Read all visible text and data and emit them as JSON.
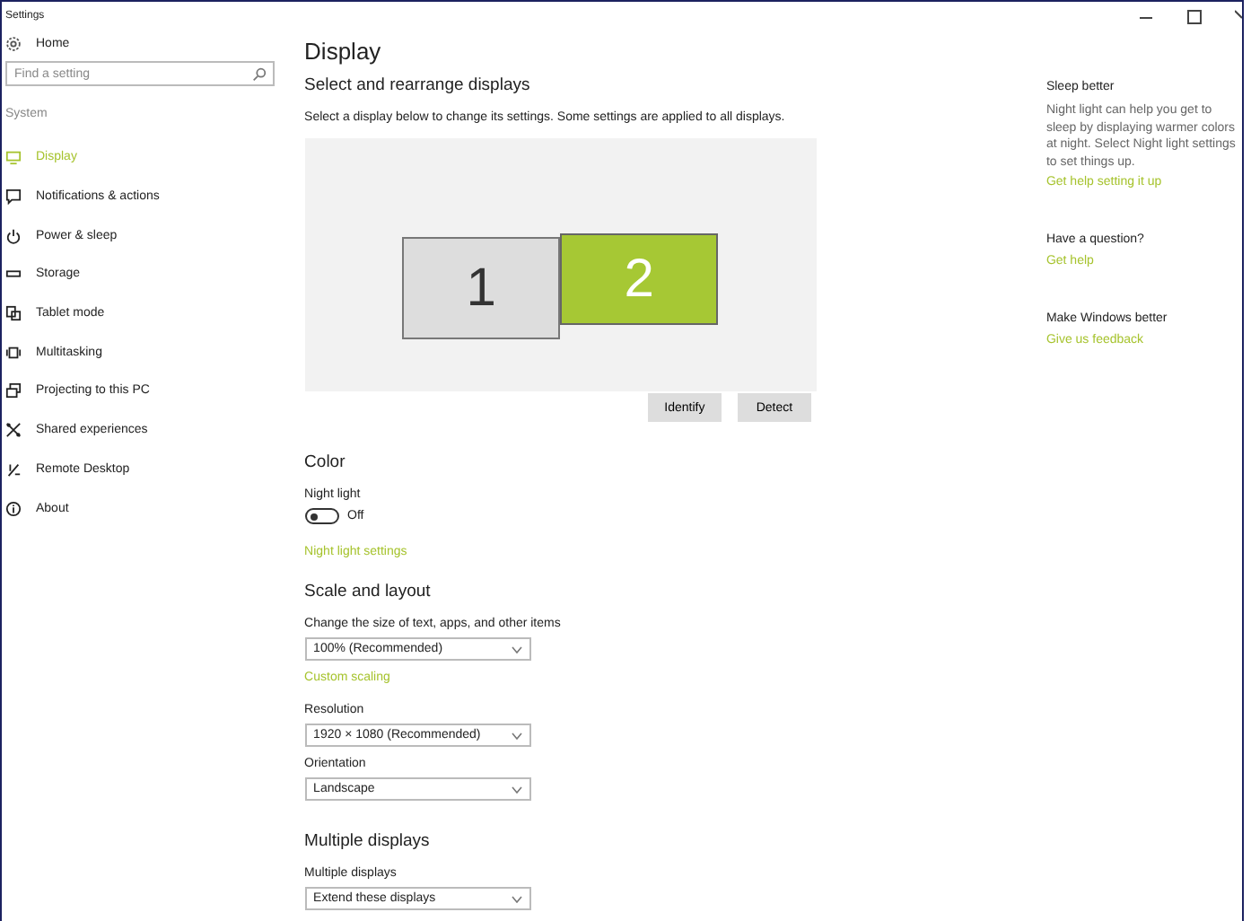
{
  "window": {
    "title": "Settings"
  },
  "sidebar": {
    "home": "Home",
    "search": {
      "placeholder": "Find a setting"
    },
    "group": "System",
    "items": [
      {
        "label": "Display",
        "selected": true
      },
      {
        "label": "Notifications & actions",
        "selected": false
      },
      {
        "label": "Power & sleep",
        "selected": false
      },
      {
        "label": "Storage",
        "selected": false
      },
      {
        "label": "Tablet mode",
        "selected": false
      },
      {
        "label": "Multitasking",
        "selected": false
      },
      {
        "label": "Projecting to this PC",
        "selected": false
      },
      {
        "label": "Shared experiences",
        "selected": false
      },
      {
        "label": "Remote Desktop",
        "selected": false
      },
      {
        "label": "About",
        "selected": false
      }
    ]
  },
  "page": {
    "title": "Display",
    "arrange": {
      "heading": "Select and rearrange displays",
      "description": "Select a display below to change its settings. Some settings are applied to all displays.",
      "displays": [
        {
          "label": "1",
          "selected": false
        },
        {
          "label": "2",
          "selected": true
        }
      ],
      "buttons": [
        "Identify",
        "Detect"
      ]
    },
    "color": {
      "heading": "Color",
      "night_light": {
        "label": "Night light",
        "on": false,
        "state_text": "Off"
      },
      "link": "Night light settings"
    },
    "scale": {
      "heading": "Scale and layout",
      "size": {
        "label": "Change the size of text, apps, and other items",
        "value": "100% (Recommended)"
      },
      "link": "Custom scaling",
      "resolution": {
        "label": "Resolution",
        "value": "1920 × 1080 (Recommended)"
      },
      "orientation": {
        "label": "Orientation",
        "value": "Landscape"
      }
    },
    "multiple": {
      "heading": "Multiple displays",
      "field": {
        "label": "Multiple displays",
        "value": "Extend these displays"
      }
    }
  },
  "aside": [
    {
      "heading": "Sleep better",
      "text": "Night light can help you get to sleep by displaying warmer colors at night. Select Night light settings to set things up.",
      "link": "Get help setting it up"
    },
    {
      "heading": "Have a question?",
      "link": "Get help"
    },
    {
      "heading": "Make Windows better",
      "link": "Give us feedback"
    }
  ]
}
